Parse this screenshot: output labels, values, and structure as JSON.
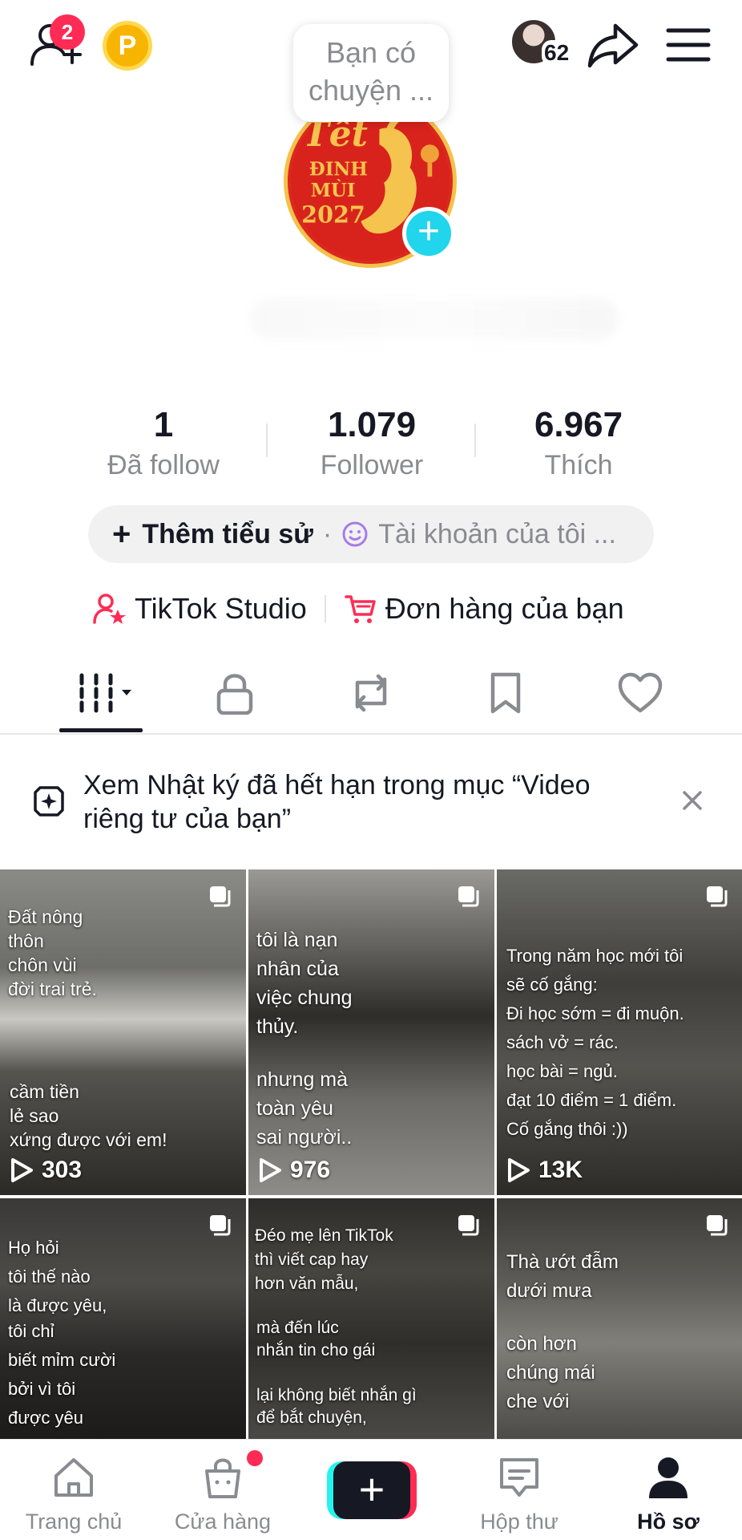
{
  "top_bar": {
    "notification_count": "2",
    "coin_label": "P",
    "story_prompt_line1": "Bạn có",
    "story_prompt_line2": "chuyện ...",
    "friends_count": "62"
  },
  "profile": {
    "avatar_text_line1": "Tết",
    "avatar_text_line2": "ĐINH",
    "avatar_text_line3": "MÙI",
    "avatar_text_line4": "2027",
    "add_button": "+"
  },
  "stats": {
    "following_count": "1",
    "following_label": "Đã follow",
    "followers_count": "1.079",
    "followers_label": "Follower",
    "likes_count": "6.967",
    "likes_label": "Thích"
  },
  "bio": {
    "plus": "+",
    "add_bio_label": "Thêm tiểu sử",
    "separator": "·",
    "account_label": "Tài khoản của tôi ..."
  },
  "shortcuts": {
    "studio_label": "TikTok Studio",
    "orders_label": "Đơn hàng của bạn"
  },
  "banner": {
    "text": "Xem Nhật ký đã hết hạn trong mục “Video riêng tư của bạn”"
  },
  "videos": [
    {
      "caption_top": "Đất nông\nthôn\nchôn vùi\nđời trai trẻ.",
      "caption_bottom": "cầm tiền\nlẻ sao\nxứng được với em!",
      "views": "303"
    },
    {
      "caption_top": "tôi là nạn\nnhân của\nviệc chung\nthủy.",
      "caption_bottom": "nhưng mà\ntoàn yêu\nsai người..",
      "views": "976"
    },
    {
      "caption_top": "Trong năm học mới tôi\nsẽ cố gắng:\nĐi học sớm = đi muộn.\nsách vở = rác.\nhọc bài = ngủ.\nđạt 10 điểm = 1 điểm.\nCố gắng thôi :))",
      "caption_bottom": "",
      "views": "13K"
    },
    {
      "caption_top": "Họ hỏi\ntôi thế nào\nlà được yêu,",
      "caption_bottom": "tôi chỉ\nbiết mỉm cười\nbởi vì tôi\nđược yêu",
      "views": ""
    },
    {
      "caption_top": "Đéo mẹ lên TikTok\nthì viết cap hay\n hơn văn mẫu,",
      "caption_bottom": "mà đến lúc\nnhắn tin cho gái\n\nlại không biết nhắn gì\nđể bắt chuyện,",
      "views": ""
    },
    {
      "caption_top": "Thà ướt đẫm\ndưới mưa",
      "caption_bottom": "còn hơn\n chúng mái\nche với",
      "views": ""
    }
  ],
  "bottom_nav": {
    "home": "Trang chủ",
    "shop": "Cửa hàng",
    "create": "+",
    "inbox": "Hộp thư",
    "profile": "Hồ sơ"
  },
  "colors": {
    "accent_red": "#fe2c55",
    "accent_cyan": "#20d5ec",
    "coin": "#f7b400",
    "text_primary": "#161823",
    "text_secondary": "#8a8b91"
  }
}
